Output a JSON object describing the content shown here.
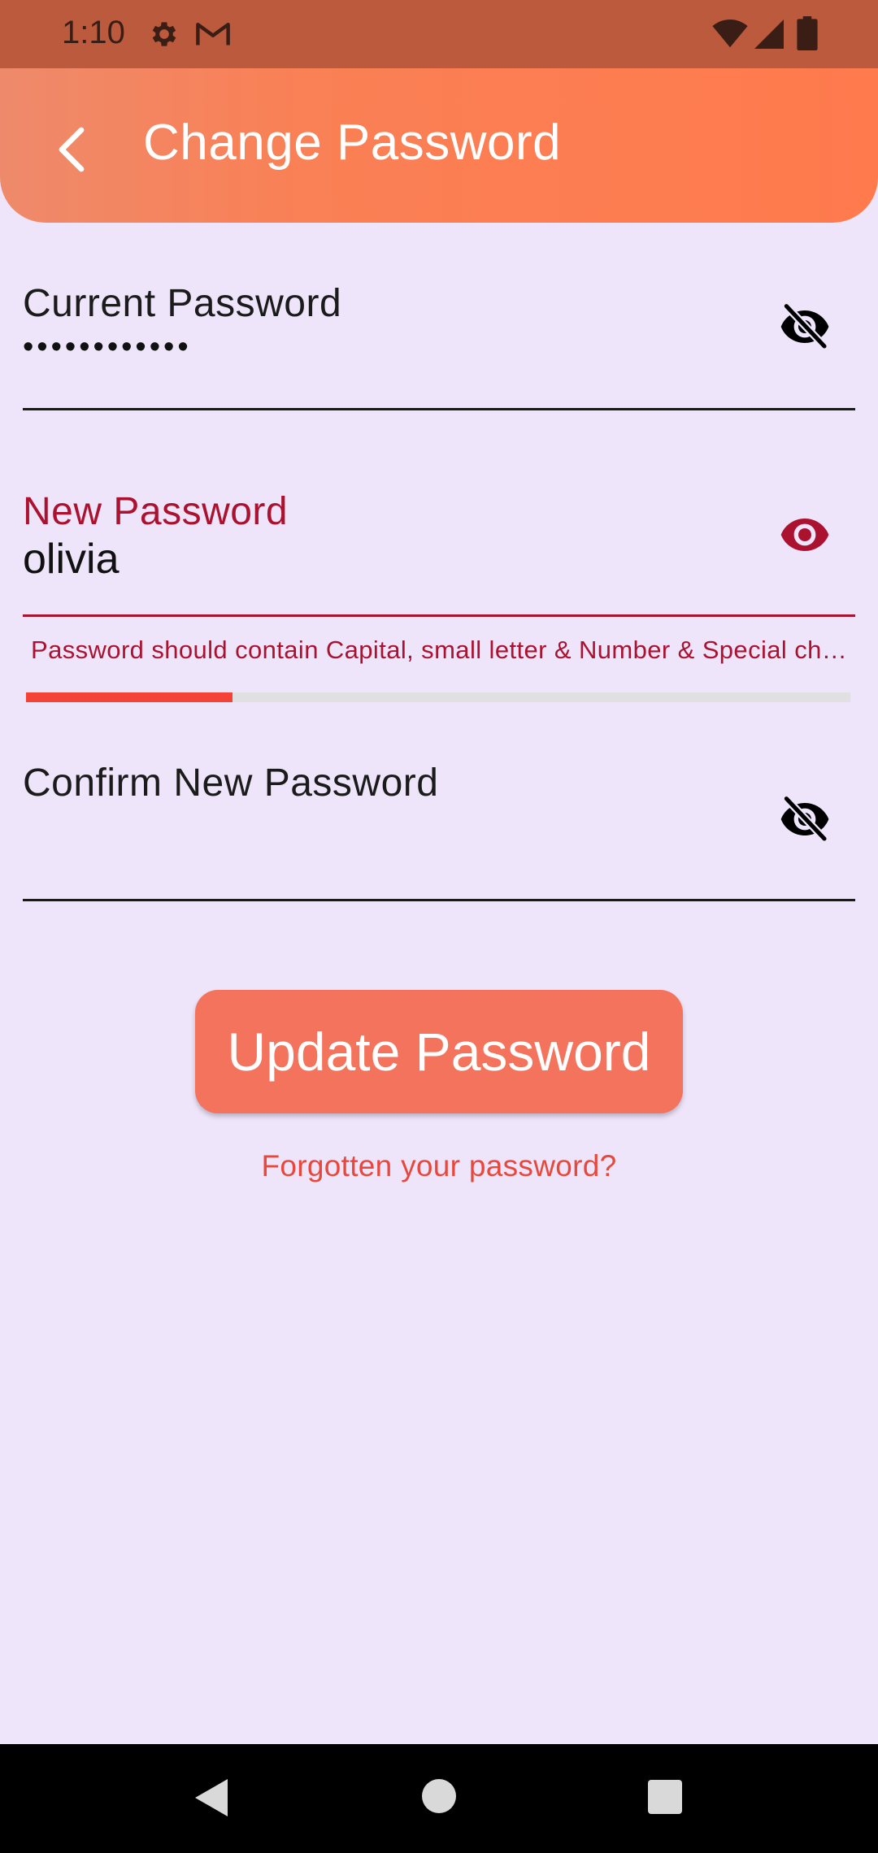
{
  "status_bar": {
    "time": "1:10",
    "icons": [
      "gear-icon",
      "gmail-icon",
      "wifi-icon",
      "signal-icon",
      "battery-icon"
    ]
  },
  "header": {
    "title": "Change Password",
    "back_icon": "chevron-left-icon",
    "gradient_colors": [
      "#EE8A6B",
      "#FF7A4D"
    ]
  },
  "form": {
    "current_password": {
      "label": "Current Password",
      "value": "••••••••••••",
      "visibility_icon": "eye-off-icon"
    },
    "new_password": {
      "label": "New Password",
      "value": "olivia",
      "visibility_icon": "eye-icon",
      "error": "Password should contain Capital, small letter & Number & Special character",
      "strength": 0.25,
      "strength_color": "#F44336"
    },
    "confirm_password": {
      "label": "Confirm New Password",
      "value": "",
      "visibility_icon": "eye-off-icon"
    }
  },
  "actions": {
    "update_label": "Update Password",
    "forgot_label": "Forgotten your password?"
  },
  "colors": {
    "background": "#EFE5FB",
    "accent": "#F4735C",
    "error": "#AB1230",
    "link": "#E8483B"
  },
  "nav_bar": {
    "icons": [
      "back-triangle-icon",
      "home-circle-icon",
      "recent-square-icon"
    ]
  }
}
